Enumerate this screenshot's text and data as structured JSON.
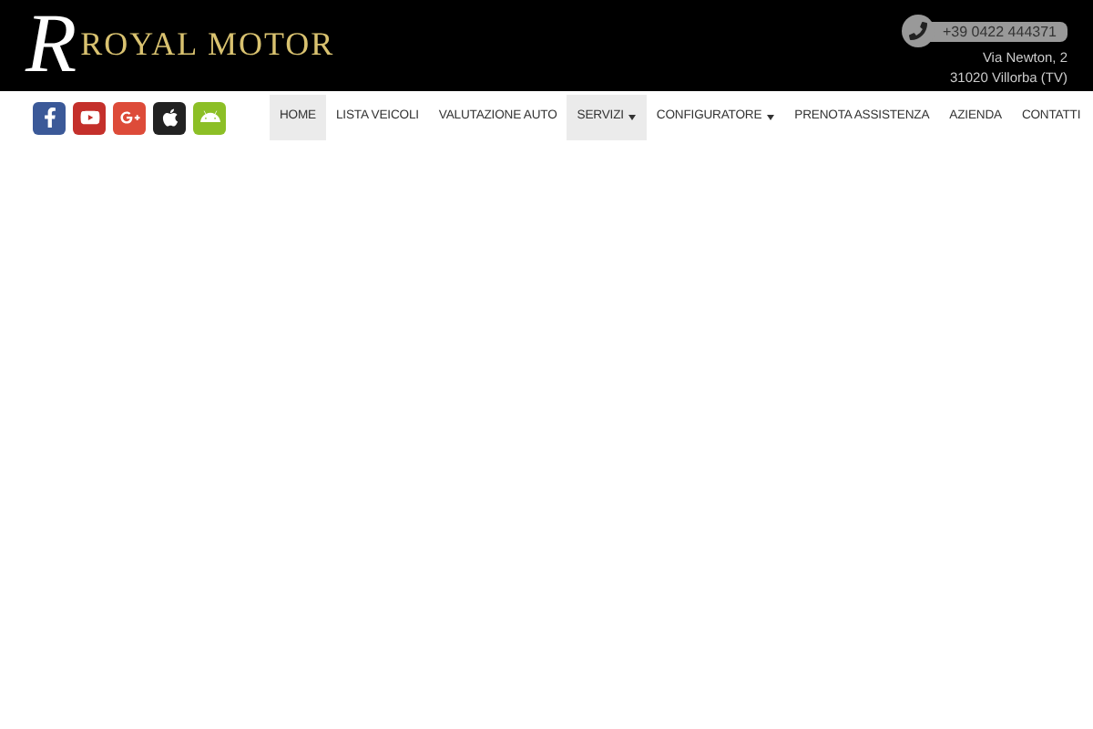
{
  "header": {
    "logo_letter": "R",
    "brand": "ROYAL MOTOR",
    "phone": "+39 0422 444371",
    "address_lines": [
      "Via Newton, 2",
      "31020 Villorba (TV)"
    ]
  },
  "social": [
    {
      "kind": "facebook",
      "color": "#3b5998"
    },
    {
      "kind": "youtube",
      "color": "#c4302b"
    },
    {
      "kind": "googleplus",
      "color": "#dd4b39"
    },
    {
      "kind": "apple",
      "color": "#222222"
    },
    {
      "kind": "android",
      "color": "#8cbf26"
    }
  ],
  "nav": [
    {
      "label": "HOME",
      "selected": true,
      "dropdown": false
    },
    {
      "label": "LISTA VEICOLI",
      "selected": false,
      "dropdown": false
    },
    {
      "label": "VALUTAZIONE AUTO",
      "selected": false,
      "dropdown": false
    },
    {
      "label": "SERVIZI",
      "selected": true,
      "dropdown": true
    },
    {
      "label": "CONFIGURATORE",
      "selected": false,
      "dropdown": true
    },
    {
      "label": "PRENOTA ASSISTENZA",
      "selected": false,
      "dropdown": false
    },
    {
      "label": "AZIENDA",
      "selected": false,
      "dropdown": false
    },
    {
      "label": "CONTATTI",
      "selected": false,
      "dropdown": false
    }
  ]
}
